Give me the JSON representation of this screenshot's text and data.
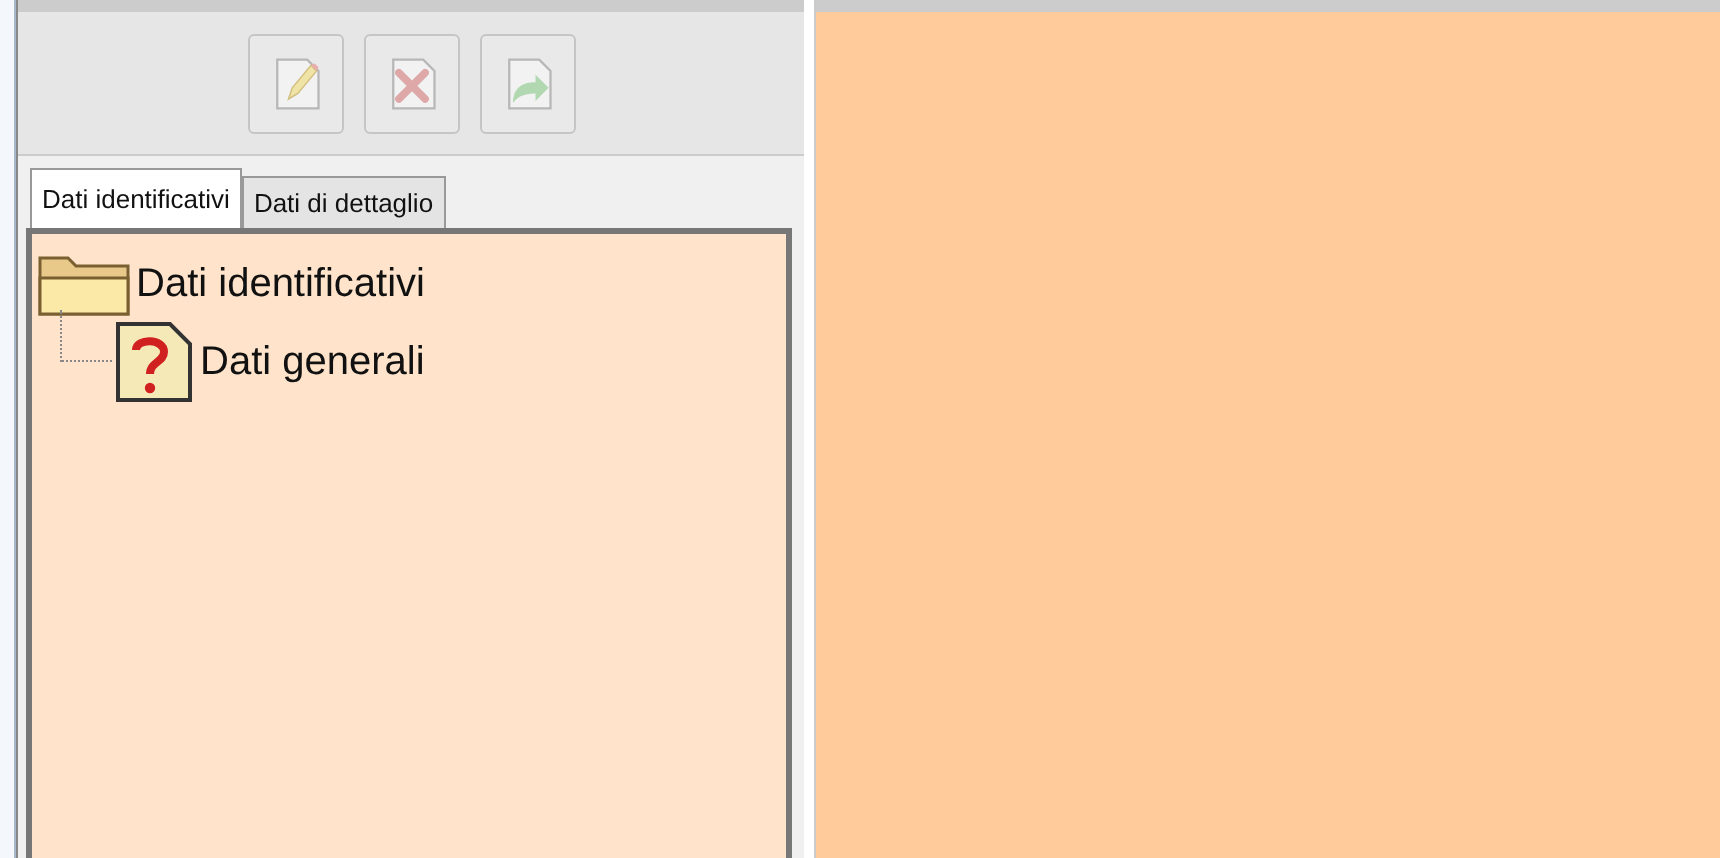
{
  "toolbar": [
    {
      "kind": "edit",
      "disabled": true
    },
    {
      "kind": "delete",
      "disabled": true
    },
    {
      "kind": "export",
      "disabled": true
    }
  ],
  "tabs": [
    {
      "label": "Dati identificativi",
      "selected": true
    },
    {
      "label": "Dati di dettaglio",
      "selected": false
    }
  ],
  "tree": [
    {
      "label": "Dati identificativi",
      "kind": "folder",
      "children": [
        {
          "label": "Dati generali",
          "kind": "unknown"
        }
      ]
    }
  ]
}
